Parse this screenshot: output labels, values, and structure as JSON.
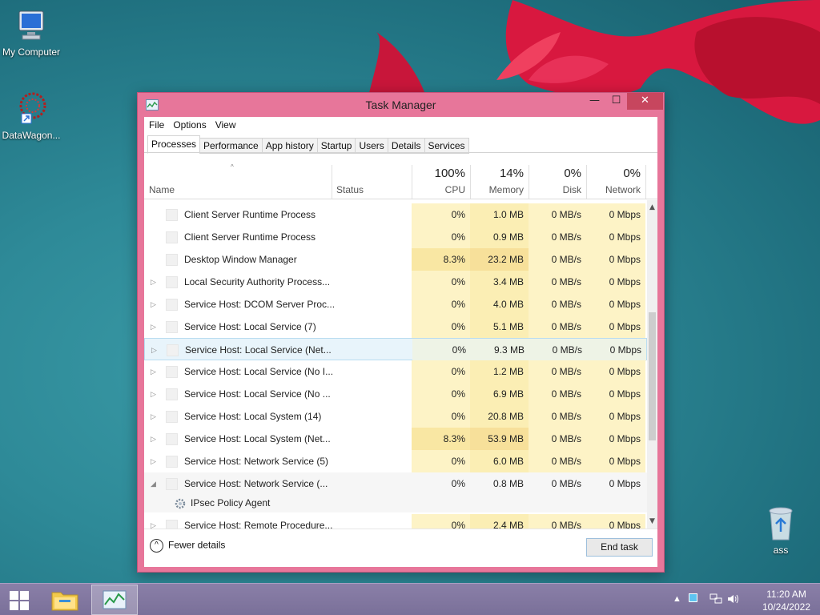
{
  "desktop": {
    "icons": [
      {
        "label": "My Computer"
      },
      {
        "label": "DataWagon..."
      },
      {
        "label": "ass"
      }
    ]
  },
  "window": {
    "title": "Task Manager",
    "controls": {
      "minimize": "—",
      "maximize": "☐",
      "close": "✕"
    },
    "menu": [
      "File",
      "Options",
      "View"
    ],
    "tabs": [
      "Processes",
      "Performance",
      "App history",
      "Startup",
      "Users",
      "Details",
      "Services"
    ],
    "active_tab": "Processes",
    "columns": {
      "name": "Name",
      "status": "Status",
      "cpu": {
        "label": "CPU",
        "percent": "100%"
      },
      "memory": {
        "label": "Memory",
        "percent": "14%"
      },
      "disk": {
        "label": "Disk",
        "percent": "0%"
      },
      "network": {
        "label": "Network",
        "percent": "0%"
      }
    },
    "processes": [
      {
        "name": "Client Server Runtime Process",
        "expand": "",
        "cpu": "0%",
        "memory": "1.0 MB",
        "disk": "0 MB/s",
        "network": "0 Mbps"
      },
      {
        "name": "Client Server Runtime Process",
        "expand": "",
        "cpu": "0%",
        "memory": "0.9 MB",
        "disk": "0 MB/s",
        "network": "0 Mbps"
      },
      {
        "name": "Desktop Window Manager",
        "expand": "",
        "cpu": "8.3%",
        "memory": "23.2 MB",
        "disk": "0 MB/s",
        "network": "0 Mbps"
      },
      {
        "name": "Local Security Authority Process...",
        "expand": "▷",
        "cpu": "0%",
        "memory": "3.4 MB",
        "disk": "0 MB/s",
        "network": "0 Mbps"
      },
      {
        "name": "Service Host: DCOM Server Proc...",
        "expand": "▷",
        "cpu": "0%",
        "memory": "4.0 MB",
        "disk": "0 MB/s",
        "network": "0 Mbps"
      },
      {
        "name": "Service Host: Local Service (7)",
        "expand": "▷",
        "cpu": "0%",
        "memory": "5.1 MB",
        "disk": "0 MB/s",
        "network": "0 Mbps"
      },
      {
        "name": "Service Host: Local Service (Net...",
        "expand": "▷",
        "cpu": "0%",
        "memory": "9.3 MB",
        "disk": "0 MB/s",
        "network": "0 Mbps"
      },
      {
        "name": "Service Host: Local Service (No I...",
        "expand": "▷",
        "cpu": "0%",
        "memory": "1.2 MB",
        "disk": "0 MB/s",
        "network": "0 Mbps"
      },
      {
        "name": "Service Host: Local Service (No ...",
        "expand": "▷",
        "cpu": "0%",
        "memory": "6.9 MB",
        "disk": "0 MB/s",
        "network": "0 Mbps"
      },
      {
        "name": "Service Host: Local System (14)",
        "expand": "▷",
        "cpu": "0%",
        "memory": "20.8 MB",
        "disk": "0 MB/s",
        "network": "0 Mbps"
      },
      {
        "name": "Service Host: Local System (Net...",
        "expand": "▷",
        "cpu": "8.3%",
        "memory": "53.9 MB",
        "disk": "0 MB/s",
        "network": "0 Mbps"
      },
      {
        "name": "Service Host: Network Service (5)",
        "expand": "▷",
        "cpu": "0%",
        "memory": "6.0 MB",
        "disk": "0 MB/s",
        "network": "0 Mbps"
      },
      {
        "name": "Service Host: Network Service (...",
        "expand": "◢",
        "cpu": "0%",
        "memory": "0.8 MB",
        "disk": "0 MB/s",
        "network": "0 Mbps"
      },
      {
        "name": "IPsec Policy Agent",
        "expand": "",
        "child": true,
        "cpu": "",
        "memory": "",
        "disk": "",
        "network": ""
      },
      {
        "name": "Service Host: Remote Procedure...",
        "expand": "▷",
        "cpu": "0%",
        "memory": "2.4 MB",
        "disk": "0 MB/s",
        "network": "0 Mbps"
      }
    ],
    "footer": {
      "fewer_details": "Fewer details",
      "end_task": "End task"
    }
  },
  "taskbar": {
    "clock_time": "11:20 AM",
    "clock_date": "10/24/2022"
  }
}
